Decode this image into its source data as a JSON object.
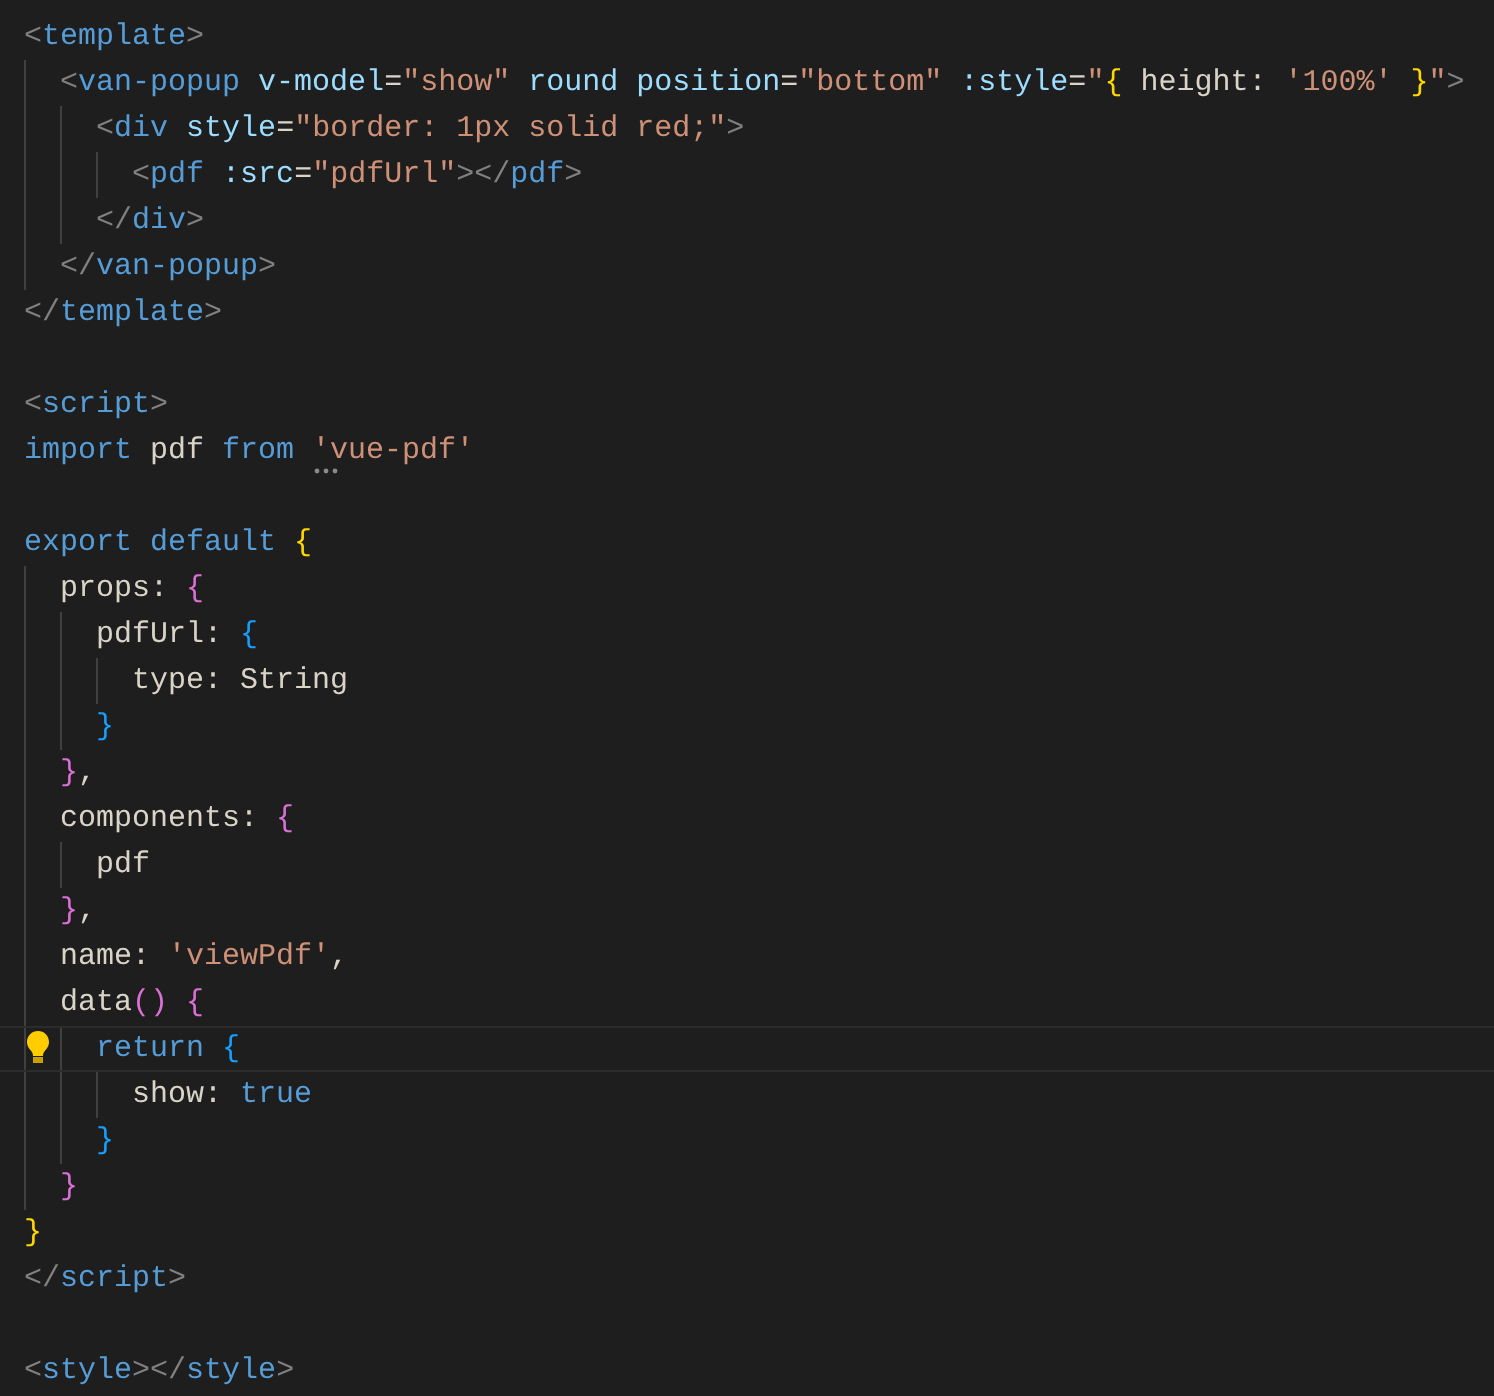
{
  "editor": {
    "lines": [
      {
        "current": false,
        "hint": false,
        "tokens": [
          {
            "text": "<",
            "kind": "angle"
          },
          {
            "text": "template",
            "kind": "tag"
          },
          {
            "text": ">",
            "kind": "angle"
          }
        ]
      },
      {
        "current": false,
        "hint": false,
        "tokens": [
          {
            "text": "  <",
            "kind": "angle"
          },
          {
            "text": "van-popup",
            "kind": "tag"
          },
          {
            "text": " v-model",
            "kind": "attr"
          },
          {
            "text": "=",
            "kind": "plain"
          },
          {
            "text": "\"show\"",
            "kind": "string"
          },
          {
            "text": " round position",
            "kind": "attr"
          },
          {
            "text": "=",
            "kind": "plain"
          },
          {
            "text": "\"bottom\"",
            "kind": "string"
          },
          {
            "text": " :style",
            "kind": "attr"
          },
          {
            "text": "=",
            "kind": "plain"
          },
          {
            "text": "\"",
            "kind": "string"
          },
          {
            "text": "{",
            "kind": "bracket1"
          },
          {
            "text": " height: ",
            "kind": "plain"
          },
          {
            "text": "'100%' ",
            "kind": "string"
          },
          {
            "text": "}",
            "kind": "bracket1"
          },
          {
            "text": "\"",
            "kind": "string"
          },
          {
            "text": ">",
            "kind": "angle"
          }
        ]
      },
      {
        "current": false,
        "hint": false,
        "tokens": [
          {
            "text": "    <",
            "kind": "angle"
          },
          {
            "text": "div",
            "kind": "tag"
          },
          {
            "text": " style",
            "kind": "attr"
          },
          {
            "text": "=",
            "kind": "plain"
          },
          {
            "text": "\"border: 1px solid red;\"",
            "kind": "string"
          },
          {
            "text": ">",
            "kind": "angle"
          }
        ]
      },
      {
        "current": false,
        "hint": false,
        "tokens": [
          {
            "text": "      <",
            "kind": "angle"
          },
          {
            "text": "pdf",
            "kind": "tag"
          },
          {
            "text": " :src",
            "kind": "attr"
          },
          {
            "text": "=",
            "kind": "plain"
          },
          {
            "text": "\"pdfUrl\"",
            "kind": "string"
          },
          {
            "text": "></",
            "kind": "angle"
          },
          {
            "text": "pdf",
            "kind": "tag"
          },
          {
            "text": ">",
            "kind": "angle"
          }
        ]
      },
      {
        "current": false,
        "hint": false,
        "tokens": [
          {
            "text": "    </",
            "kind": "angle"
          },
          {
            "text": "div",
            "kind": "tag"
          },
          {
            "text": ">",
            "kind": "angle"
          }
        ]
      },
      {
        "current": false,
        "hint": false,
        "tokens": [
          {
            "text": "  </",
            "kind": "angle"
          },
          {
            "text": "van-popup",
            "kind": "tag"
          },
          {
            "text": ">",
            "kind": "angle"
          }
        ]
      },
      {
        "current": false,
        "hint": false,
        "tokens": [
          {
            "text": "</",
            "kind": "angle"
          },
          {
            "text": "template",
            "kind": "tag"
          },
          {
            "text": ">",
            "kind": "angle"
          }
        ]
      },
      {
        "current": false,
        "hint": false
      },
      {
        "current": false,
        "hint": false,
        "tokens": [
          {
            "text": "<",
            "kind": "angle"
          },
          {
            "text": "script",
            "kind": "tag"
          },
          {
            "text": ">",
            "kind": "angle"
          }
        ]
      },
      {
        "current": false,
        "hint": true,
        "tokens": [
          {
            "text": "import",
            "kind": "keyword"
          },
          {
            "text": " pdf ",
            "kind": "plain"
          },
          {
            "text": "from ",
            "kind": "keyword"
          },
          {
            "text": "'vue-pdf'",
            "kind": "string"
          }
        ]
      },
      {
        "current": false,
        "hint": false
      },
      {
        "current": false,
        "hint": false,
        "tokens": [
          {
            "text": "export default ",
            "kind": "keyword"
          },
          {
            "text": "{",
            "kind": "bracket1"
          }
        ]
      },
      {
        "current": false,
        "hint": false,
        "tokens": [
          {
            "text": "  props: ",
            "kind": "plain"
          },
          {
            "text": "{",
            "kind": "bracket2"
          }
        ]
      },
      {
        "current": false,
        "hint": false,
        "tokens": [
          {
            "text": "    pdfUrl: ",
            "kind": "plain"
          },
          {
            "text": "{",
            "kind": "bracket3"
          }
        ]
      },
      {
        "current": false,
        "hint": false,
        "tokens": [
          {
            "text": "      type: String",
            "kind": "plain"
          }
        ]
      },
      {
        "current": false,
        "hint": false,
        "tokens": [
          {
            "text": "    }",
            "kind": "bracket3"
          }
        ]
      },
      {
        "current": false,
        "hint": false,
        "tokens": [
          {
            "text": "  }",
            "kind": "bracket2"
          },
          {
            "text": ",",
            "kind": "plain"
          }
        ]
      },
      {
        "current": false,
        "hint": false,
        "tokens": [
          {
            "text": "  components: ",
            "kind": "plain"
          },
          {
            "text": "{",
            "kind": "bracket2"
          }
        ]
      },
      {
        "current": false,
        "hint": false,
        "tokens": [
          {
            "text": "    pdf",
            "kind": "plain"
          }
        ]
      },
      {
        "current": false,
        "hint": false,
        "tokens": [
          {
            "text": "  }",
            "kind": "bracket2"
          },
          {
            "text": ",",
            "kind": "plain"
          }
        ]
      },
      {
        "current": false,
        "hint": false,
        "tokens": [
          {
            "text": "  name: ",
            "kind": "plain"
          },
          {
            "text": "'viewPdf'",
            "kind": "string"
          },
          {
            "text": ",",
            "kind": "plain"
          }
        ]
      },
      {
        "current": false,
        "hint": false,
        "tokens": [
          {
            "text": "  data",
            "kind": "plain"
          },
          {
            "text": "() ",
            "kind": "bracket2"
          },
          {
            "text": "{",
            "kind": "bracket2"
          }
        ]
      },
      {
        "current": true,
        "hint": false,
        "tokens": [
          {
            "text": "    return ",
            "kind": "keyword"
          },
          {
            "text": "{",
            "kind": "bracket3"
          }
        ]
      },
      {
        "current": false,
        "hint": false,
        "tokens": [
          {
            "text": "      show: ",
            "kind": "plain"
          },
          {
            "text": "true",
            "kind": "keyword"
          }
        ]
      },
      {
        "current": false,
        "hint": false,
        "tokens": [
          {
            "text": "    }",
            "kind": "bracket3"
          }
        ]
      },
      {
        "current": false,
        "hint": false,
        "tokens": [
          {
            "text": "  }",
            "kind": "bracket2"
          }
        ]
      },
      {
        "current": false,
        "hint": false,
        "tokens": [
          {
            "text": "}",
            "kind": "bracket1"
          }
        ]
      },
      {
        "current": false,
        "hint": false,
        "tokens": [
          {
            "text": "</",
            "kind": "angle"
          },
          {
            "text": "script",
            "kind": "tag"
          },
          {
            "text": ">",
            "kind": "angle"
          }
        ]
      },
      {
        "current": false,
        "hint": false
      },
      {
        "current": false,
        "hint": false,
        "tokens": [
          {
            "text": "<",
            "kind": "angle"
          },
          {
            "text": "style",
            "kind": "tag"
          },
          {
            "text": "></",
            "kind": "angle"
          },
          {
            "text": "style",
            "kind": "tag"
          },
          {
            "text": ">",
            "kind": "angle"
          }
        ]
      }
    ]
  }
}
